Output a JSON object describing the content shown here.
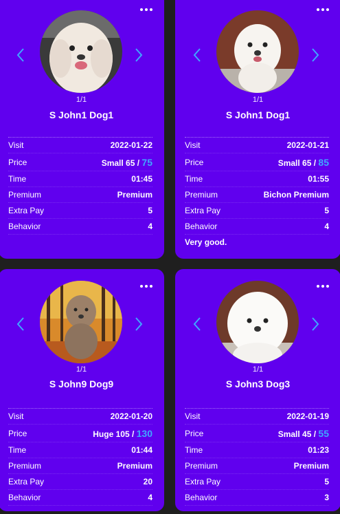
{
  "labels": {
    "visit": "Visit",
    "price": "Price",
    "time": "Time",
    "premium": "Premium",
    "extra_pay": "Extra Pay",
    "behavior": "Behavior"
  },
  "colors": {
    "card_bg": "#6000ee",
    "page_bg": "#1f1f1f",
    "accent": "#3fa8ff"
  },
  "cards": [
    {
      "pager": "1/1",
      "name": "S John1 Dog1",
      "visit": "2022-01-22",
      "price_prefix": "Small 65 /",
      "price_total": "75",
      "time": "01:45",
      "premium": "Premium",
      "extra_pay": "5",
      "behavior": "4",
      "note": ""
    },
    {
      "pager": "1/1",
      "name": "S John1 Dog1",
      "visit": "2022-01-21",
      "price_prefix": "Small 65 /",
      "price_total": "85",
      "time": "01:55",
      "premium": "Bichon Premium",
      "extra_pay": "5",
      "behavior": "4",
      "note": "Very good."
    },
    {
      "pager": "1/1",
      "name": "S John9 Dog9",
      "visit": "2022-01-20",
      "price_prefix": "Huge 105 /",
      "price_total": "130",
      "time": "01:44",
      "premium": "Premium",
      "extra_pay": "20",
      "behavior": "4",
      "note": ""
    },
    {
      "pager": "1/1",
      "name": "S John3 Dog3",
      "visit": "2022-01-19",
      "price_prefix": "Small 45 /",
      "price_total": "55",
      "time": "01:23",
      "premium": "Premium",
      "extra_pay": "5",
      "behavior": "3",
      "note": ""
    }
  ]
}
